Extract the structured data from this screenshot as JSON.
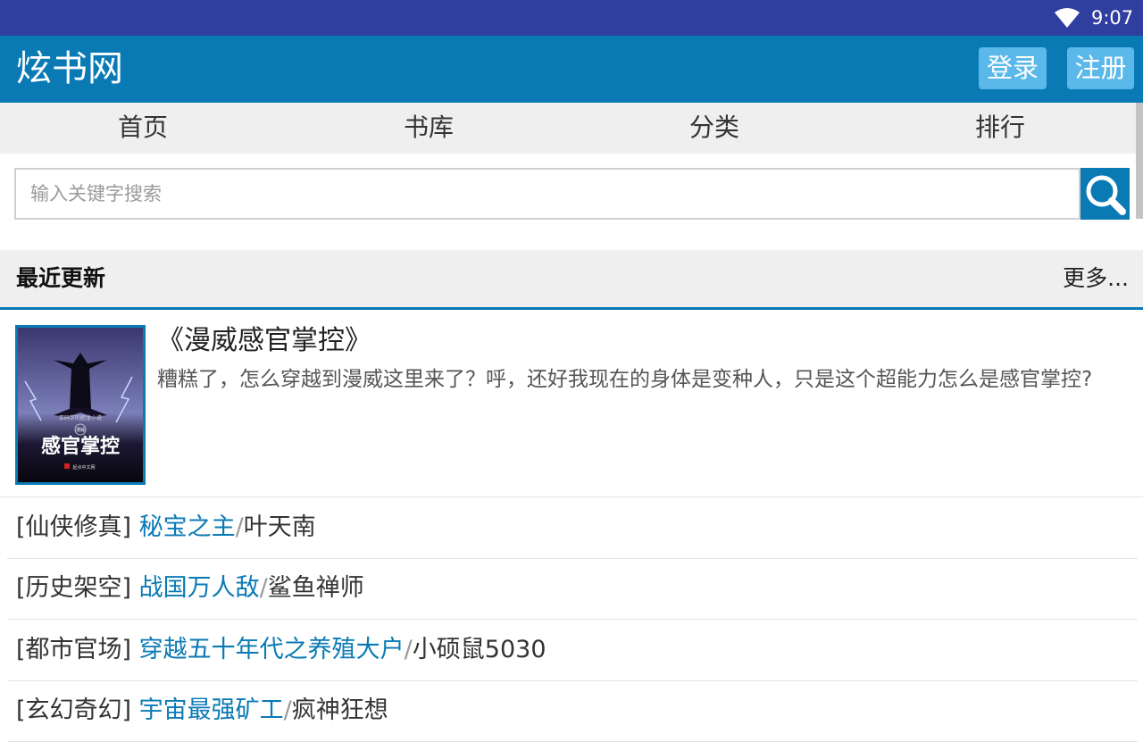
{
  "status_bar": {
    "time": "9:07",
    "wifi_icon": "wifi-icon"
  },
  "header": {
    "title": "炫书网",
    "login_label": "登录",
    "register_label": "注册"
  },
  "nav": {
    "items": [
      "首页",
      "书库",
      "分类",
      "排行"
    ]
  },
  "search": {
    "placeholder": "输入关键字搜索",
    "value": "",
    "button_icon": "search-icon"
  },
  "section": {
    "title": "最近更新",
    "more_label": "更多..."
  },
  "featured": {
    "title": "《漫威感官掌控》",
    "description": "糟糕了，怎么穿越到漫威这里来了？呼，还好我现在的身体是变种人，只是这个超能力怎么是感官掌控?",
    "cover": {
      "small_text": "正码字的肥龙小说",
      "tag": "漫威",
      "big_text": "感官掌控",
      "publisher": "起点中文网"
    }
  },
  "books": [
    {
      "category": "[仙侠修真]",
      "title": "秘宝之主",
      "author": "叶天南"
    },
    {
      "category": "[历史架空]",
      "title": "战国万人敌",
      "author": "鲨鱼禅师"
    },
    {
      "category": "[都市官场]",
      "title": "穿越五十年代之养殖大户",
      "author": "小硕鼠5030"
    },
    {
      "category": "[玄幻奇幻]",
      "title": "宇宙最强矿工",
      "author": "疯神狂想"
    }
  ],
  "separator": "/",
  "colors": {
    "status_bar": "#303f9f",
    "header": "#0a7ab5",
    "button": "#5bb8ea",
    "link": "#0a7ab5",
    "nav_bg": "#efefef"
  }
}
